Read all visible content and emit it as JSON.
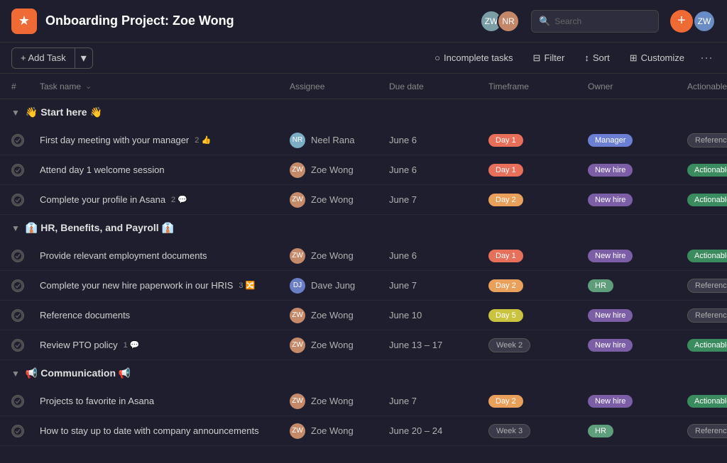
{
  "header": {
    "icon": "★",
    "title": "Onboarding Project: Zoe Wong",
    "search_placeholder": "Search",
    "add_btn": "+"
  },
  "toolbar": {
    "add_task": "+ Add Task",
    "add_dropdown": "▾",
    "incomplete_tasks": "Incomplete tasks",
    "filter": "Filter",
    "sort": "Sort",
    "customize": "Customize",
    "more": "···"
  },
  "columns": {
    "number": "#",
    "task_name": "Task name",
    "assignee": "Assignee",
    "due_date": "Due date",
    "timeframe": "Timeframe",
    "owner": "Owner",
    "actionable": "Actionable?"
  },
  "sections": [
    {
      "id": "start-here",
      "title": "👋 Start here 👋",
      "tasks": [
        {
          "name": "First day meeting with your manager",
          "meta": "2 👍",
          "assignee": "Neel Rana",
          "assignee_initials": "NR",
          "due_date": "June 6",
          "timeframe": "Day 1",
          "timeframe_class": "badge-day1",
          "owner": "Manager",
          "owner_class": "badge-manager",
          "actionable": "Reference",
          "actionable_class": "badge-reference"
        },
        {
          "name": "Attend day 1 welcome session",
          "meta": "",
          "assignee": "Zoe Wong",
          "assignee_initials": "ZW",
          "due_date": "June 6",
          "timeframe": "Day 1",
          "timeframe_class": "badge-day1",
          "owner": "New hire",
          "owner_class": "badge-new-hire",
          "actionable": "Actionable",
          "actionable_class": "badge-actionable"
        },
        {
          "name": "Complete your profile in Asana",
          "meta": "2 💬",
          "assignee": "Zoe Wong",
          "assignee_initials": "ZW",
          "due_date": "June 7",
          "timeframe": "Day 2",
          "timeframe_class": "badge-day2",
          "owner": "New hire",
          "owner_class": "badge-new-hire",
          "actionable": "Actionable",
          "actionable_class": "badge-actionable"
        }
      ]
    },
    {
      "id": "hr-benefits",
      "title": "👔 HR, Benefits, and Payroll 👔",
      "tasks": [
        {
          "name": "Provide relevant employment documents",
          "meta": "",
          "assignee": "Zoe Wong",
          "assignee_initials": "ZW",
          "due_date": "June 6",
          "timeframe": "Day 1",
          "timeframe_class": "badge-day1",
          "owner": "New hire",
          "owner_class": "badge-new-hire",
          "actionable": "Actionable",
          "actionable_class": "badge-actionable"
        },
        {
          "name": "Complete your new hire paperwork in our HRIS",
          "meta": "3 🔀",
          "assignee": "Dave Jung",
          "assignee_initials": "DJ",
          "due_date": "June 7",
          "timeframe": "Day 2",
          "timeframe_class": "badge-day2",
          "owner": "HR",
          "owner_class": "badge-hr",
          "actionable": "Reference",
          "actionable_class": "badge-reference"
        },
        {
          "name": "Reference documents",
          "meta": "",
          "assignee": "Zoe Wong",
          "assignee_initials": "ZW",
          "due_date": "June 10",
          "timeframe": "Day 5",
          "timeframe_class": "badge-day5",
          "owner": "New hire",
          "owner_class": "badge-new-hire",
          "actionable": "Reference",
          "actionable_class": "badge-reference"
        },
        {
          "name": "Review PTO policy",
          "meta": "1 💬",
          "assignee": "Zoe Wong",
          "assignee_initials": "ZW",
          "due_date": "June 13 – 17",
          "timeframe": "Week 2",
          "timeframe_class": "badge-week2",
          "owner": "New hire",
          "owner_class": "badge-new-hire",
          "actionable": "Actionable",
          "actionable_class": "badge-actionable"
        }
      ]
    },
    {
      "id": "communication",
      "title": "📢 Communication 📢",
      "tasks": [
        {
          "name": "Projects to favorite in Asana",
          "meta": "",
          "assignee": "Zoe Wong",
          "assignee_initials": "ZW",
          "due_date": "June 7",
          "timeframe": "Day 2",
          "timeframe_class": "badge-day2",
          "owner": "New hire",
          "owner_class": "badge-new-hire",
          "actionable": "Actionable",
          "actionable_class": "badge-actionable"
        },
        {
          "name": "How to stay up to date with company announcements",
          "meta": "",
          "assignee": "Zoe Wong",
          "assignee_initials": "ZW",
          "due_date": "June 20 – 24",
          "timeframe": "Week 3",
          "timeframe_class": "badge-week3",
          "owner": "HR",
          "owner_class": "badge-hr",
          "actionable": "Reference",
          "actionable_class": "badge-reference"
        }
      ]
    }
  ]
}
